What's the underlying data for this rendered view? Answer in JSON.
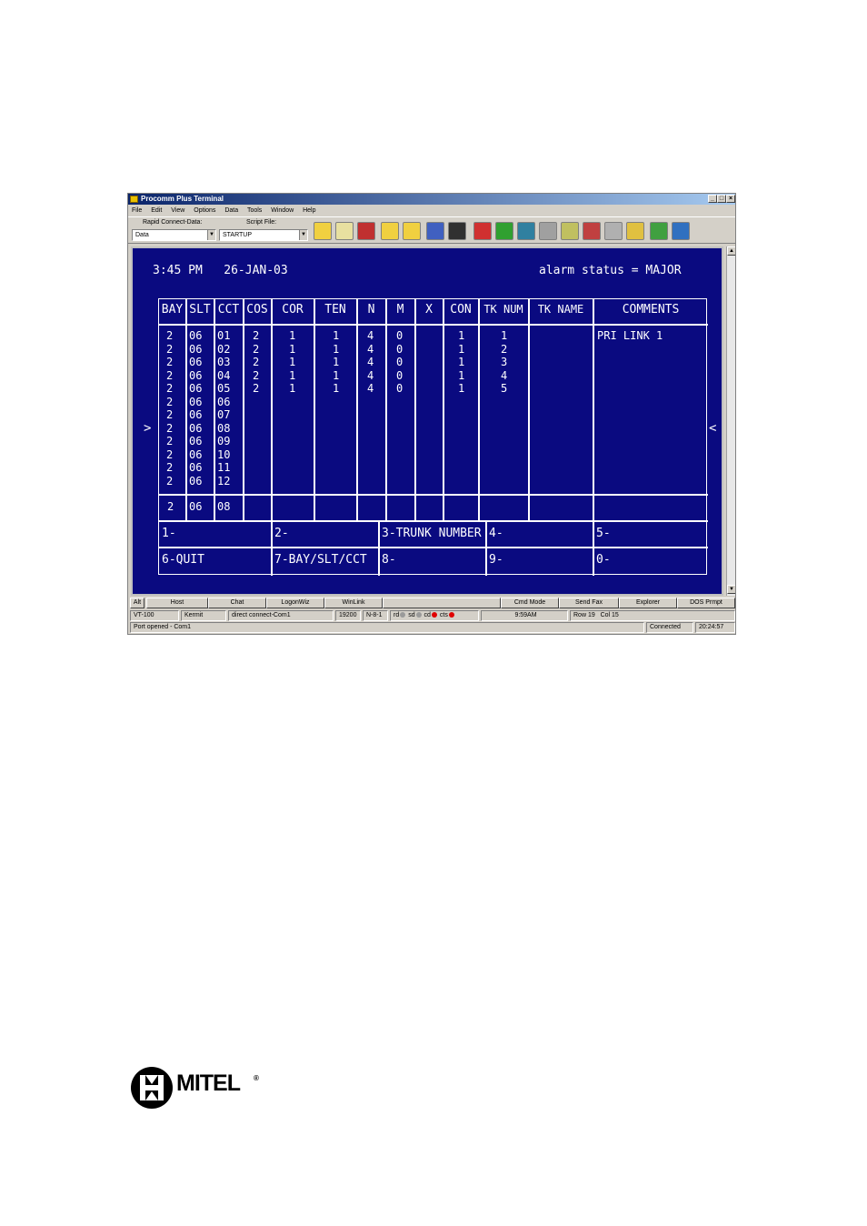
{
  "window": {
    "title": "Procomm Plus Terminal",
    "menu": [
      "File",
      "Edit",
      "View",
      "Options",
      "Data",
      "Tools",
      "Window",
      "Help"
    ],
    "rapid_connect_label": "Rapid Connect-Data:",
    "rapid_connect_value": "Data",
    "script_file_label": "Script File:",
    "script_file_value": "STARTUP"
  },
  "terminal": {
    "time_date": "3:45 PM   26-JAN-03",
    "alarm_status": "alarm status = MAJOR",
    "columns": [
      "BAY",
      "SLT",
      "CCT",
      "COS",
      "COR",
      "TEN",
      "N",
      "M",
      "X",
      "CON",
      "TK NUM",
      "TK NAME",
      "COMMENTS"
    ],
    "rows": {
      "bay": "2\n2\n2\n2\n2\n2\n2\n2\n2\n2\n2\n2",
      "slt": "06\n06\n06\n06\n06\n06\n06\n06\n06\n06\n06\n06",
      "cct": "01\n02\n03\n04\n05\n06\n07\n08\n09\n10\n11\n12",
      "cos": "2\n2\n2\n2\n2",
      "cor": "1\n1\n1\n1\n1",
      "ten": "1\n1\n1\n1\n1",
      "n": "4\n4\n4\n4\n4",
      "m": "0\n0\n0\n0\n0",
      "con": "1\n1\n1\n1\n1",
      "tk_num": "1\n2\n3\n4\n5",
      "comments": "PRI LINK 1"
    },
    "current": {
      "bay": "2",
      "slt": "06",
      "cct": "08"
    },
    "commands": {
      "c1": "1-",
      "c2": "2-",
      "c3": "3-TRUNK NUMBER",
      "c4": "4-",
      "c5": "5-",
      "c6": "6-QUIT",
      "c7": "7-BAY/SLT/CCT",
      "c8": "8-",
      "c9": "9-",
      "c0": "0-"
    },
    "left_arrow": ">",
    "right_arrow": "<"
  },
  "taskbar": {
    "alt": "Alt",
    "buttons": [
      "Host",
      "Chat",
      "LogonWiz",
      "WinLink",
      "",
      "Cmd Mode",
      "Send Fax",
      "Explorer",
      "DOS Prmpt"
    ]
  },
  "status": {
    "emulation": "VT-100",
    "transfer": "Kermit",
    "connection": "direct connect-Com1",
    "baud": "19200",
    "parity": "N-8-1",
    "rd": "rd",
    "sd": "sd",
    "cd": "cd",
    "cts": "cts",
    "clock": "9:59AM",
    "position": "Row 19   Col 15",
    "led_colors": {
      "rd": "#9a9a9a",
      "sd": "#9a9a9a",
      "cd": "#e00000",
      "cts": "#e00000"
    }
  },
  "port": {
    "message": "Port opened - Com1",
    "state": "Connected",
    "elapsed": "20:24:57"
  },
  "logo": {
    "word": "MITEL",
    "reg": "®"
  }
}
